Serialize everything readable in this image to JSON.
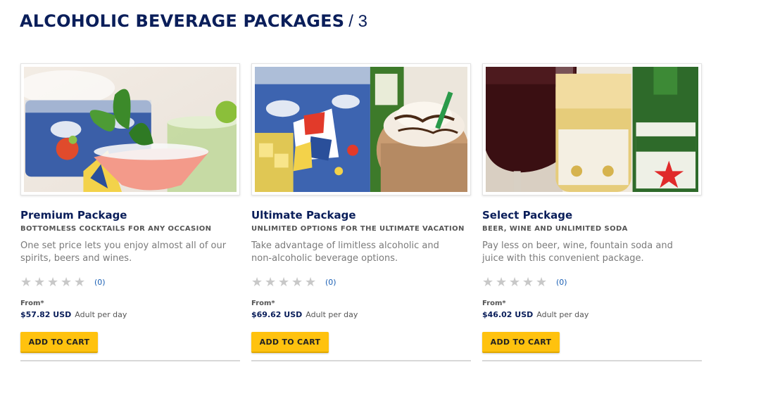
{
  "header": {
    "title": "ALCOHOLIC BEVERAGE PACKAGES",
    "count": "/ 3"
  },
  "cards": [
    {
      "title": "Premium Package",
      "subtitle": "BOTTOMLESS COCKTAILS FOR ANY OCCASION",
      "description": "One set price lets you enjoy almost all of our spirits, beers and wines.",
      "stars": 0,
      "review_count": "(0)",
      "from_label": "From*",
      "price": "$57.82 USD",
      "price_unit": "Adult per day",
      "button_label": "ADD TO CART",
      "image": "cocktails-photo"
    },
    {
      "title": "Ultimate Package",
      "subtitle": "UNLIMITED OPTIONS FOR THE ULTIMATE VACATION",
      "description": "Take advantage of limitless alcoholic and non-alcoholic beverage options.",
      "stars": 0,
      "review_count": "(0)",
      "from_label": "From*",
      "price": "$69.62 USD",
      "price_unit": "Adult per day",
      "button_label": "ADD TO CART",
      "image": "frozen-drinks-photo"
    },
    {
      "title": "Select Package",
      "subtitle": "BEER, WINE AND UNLIMITED SODA",
      "description": "Pay less on beer, wine, fountain soda and juice with this convenient package.",
      "stars": 0,
      "review_count": "(0)",
      "from_label": "From*",
      "price": "$46.02 USD",
      "price_unit": "Adult per day",
      "button_label": "ADD TO CART",
      "image": "beer-wine-photo"
    }
  ],
  "colors": {
    "title": "#0a1e5a",
    "button": "#ffc20e",
    "link": "#1a5fb4",
    "star_empty": "#c8c8c8"
  }
}
